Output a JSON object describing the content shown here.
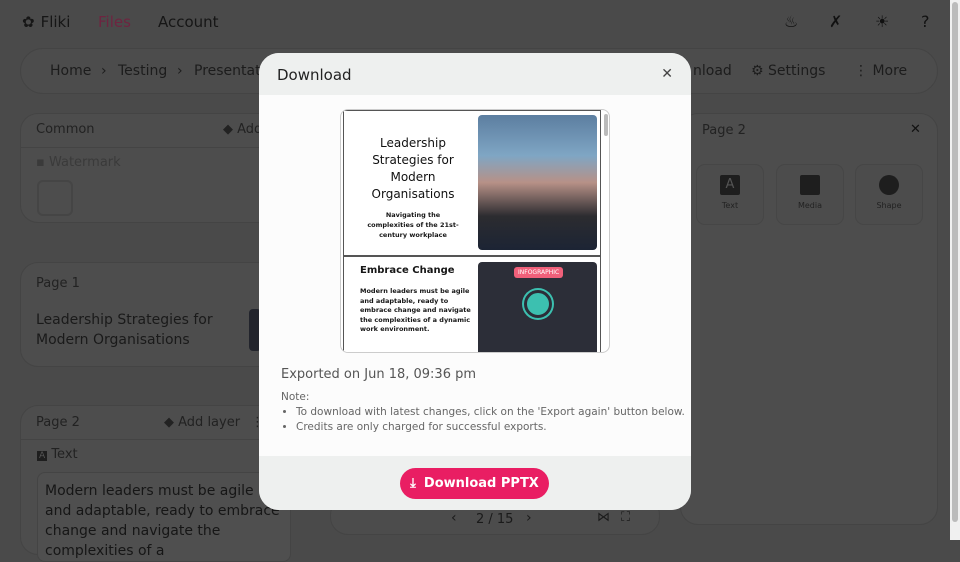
{
  "nav": {
    "brand": "Fliki",
    "links": [
      "Files",
      "Account"
    ],
    "icons": [
      "fire-icon",
      "tools-icon",
      "theme-icon",
      "help-icon"
    ]
  },
  "breadcrumb": {
    "items": [
      "Home",
      "Testing",
      "Presentati"
    ],
    "download": "nload",
    "settings": "Settings",
    "more": "More"
  },
  "common": {
    "title": "Common",
    "add": "Add",
    "watermark": "Watermark"
  },
  "page1": {
    "title": "Page 1",
    "text": "Leadership Strategies for Modern Organisations"
  },
  "page2": {
    "title": "Page 2",
    "add_layer": "Add layer",
    "layer_type": "Text",
    "text": "Modern leaders must be agile and adaptable, ready to embrace change and navigate the complexities of a"
  },
  "right_panel": {
    "title": "Page 2",
    "tools": [
      "Text",
      "Media",
      "Shape"
    ]
  },
  "pager": {
    "label": "2 / 15"
  },
  "modal": {
    "title": "Download",
    "slides": [
      {
        "title": "Leadership Strategies for Modern Organisations",
        "subtitle": "Navigating the complexities of the 21st-century workplace"
      },
      {
        "title": "Embrace Change",
        "body": "Modern leaders must be agile and adaptable, ready to embrace change and navigate the complexities of a dynamic work environment.",
        "image_label": "INFOGRAPHIC"
      }
    ],
    "exported": "Exported on Jun 18, 09:36 pm",
    "note_label": "Note:",
    "notes": [
      "To download with latest changes, click on the 'Export again' button below.",
      "Credits are only charged for successful exports."
    ],
    "button": "Download PPTX"
  },
  "colors": {
    "accent": "#e91e63",
    "overlay": "rgba(0,0,0,0.69)"
  }
}
